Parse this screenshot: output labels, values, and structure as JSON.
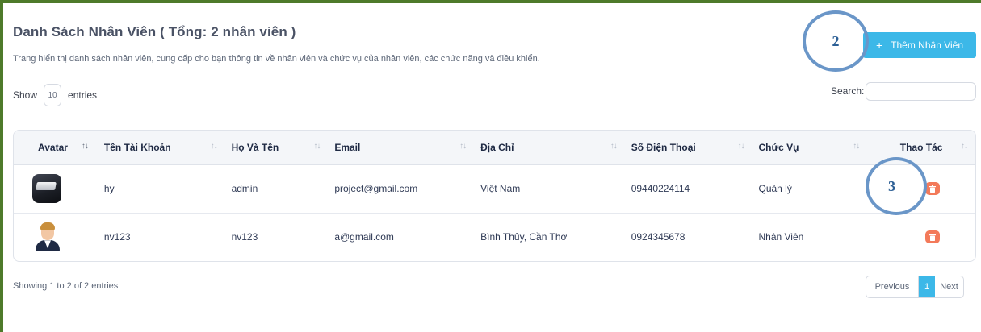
{
  "header": {
    "title": "Danh Sách Nhân Viên ( Tổng: 2 nhân viên )",
    "description": "Trang hiển thị danh sách nhân viên, cung cấp cho bạn thông tin về nhân viên và chức vụ của nhân viên, các chức năng và điều khiển.",
    "add_button_plus": "+",
    "add_button_label": "Thêm Nhân Viên"
  },
  "callouts": {
    "two": "2",
    "three": "3"
  },
  "controls": {
    "show_label": "Show",
    "entries_value": "10",
    "entries_label": "entries",
    "search_label": "Search:",
    "search_value": ""
  },
  "table": {
    "sort_glyph": "↑↓",
    "headers": [
      "Avatar",
      "Tên Tài Khoản",
      "Họ Và Tên",
      "Email",
      "Địa Chỉ",
      "Số Điện Thoại",
      "Chức Vụ",
      "Thao Tác"
    ],
    "rows": [
      {
        "avatar": "box-image",
        "username": "hy",
        "fullname": "admin",
        "email": "project@gmail.com",
        "address": "Việt Nam",
        "phone": "09440224114",
        "role": "Quản lý"
      },
      {
        "avatar": "person-avatar",
        "username": "nv123",
        "fullname": "nv123",
        "email": "a@gmail.com",
        "address": "Bình Thủy, Cần Thơ",
        "phone": "0924345678",
        "role": "Nhân Viên"
      }
    ]
  },
  "footer": {
    "info": "Showing 1 to 2 of 2 entries",
    "previous": "Previous",
    "current_page": "1",
    "next": "Next"
  },
  "colors": {
    "accent": "#3cb8e8",
    "delete": "#f37a5a",
    "frame": "#4e7a2a",
    "callout": "#6a96c8"
  }
}
